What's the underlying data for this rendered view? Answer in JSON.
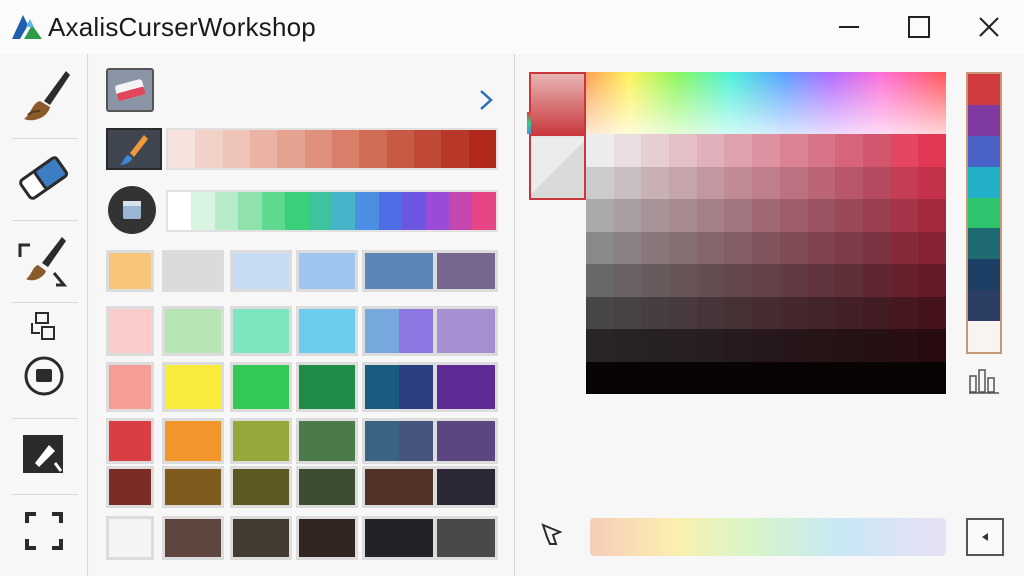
{
  "window": {
    "title": "AxalisCurserWorkshop",
    "controls": [
      "minimize",
      "maximize",
      "close"
    ]
  },
  "left_toolbar": {
    "tools": [
      "paintbrush-icon",
      "eraser-icon",
      "recolor-brush-icon",
      "replace-color-icon",
      "fill-mode-icon",
      "color-picker-icon",
      "selection-icon"
    ]
  },
  "palette": {
    "gradient_warm": [
      "#f6e3dd",
      "#f2d2c8",
      "#efc4b8",
      "#ebb3a5",
      "#e6a291",
      "#e0917d",
      "#d97f69",
      "#d06b55",
      "#c85a44",
      "#bf4836",
      "#b73828",
      "#b2291b"
    ],
    "gradient_spectrum": [
      "#ffffff",
      "#d9f5e1",
      "#b6ecc7",
      "#8fe2ab",
      "#5fd98e",
      "#39d07a",
      "#3dc49f",
      "#46b4c9",
      "#4b8fe3",
      "#4f6ee6",
      "#6a56e0",
      "#9a4cd8",
      "#c646b0",
      "#e64484"
    ],
    "top_row": [
      "#f8c67a",
      "#dadada",
      "#c6dcf2",
      "#9cc6ee",
      "#5b86b6",
      "#75678f"
    ],
    "rows": [
      [
        {
          "c": "#fbcaca"
        },
        {
          "c": "#b6e6b5"
        },
        {
          "c": "#7de6bf"
        },
        {
          "c": "#6dccec"
        },
        {
          "split": [
            "#76a8de",
            "#8e76e2"
          ]
        },
        {
          "c": "#a68fd0"
        }
      ],
      [
        {
          "c": "#f69d96"
        },
        {
          "c": "#f9eb3c"
        },
        {
          "c": "#34c956"
        },
        {
          "c": "#1f8c49"
        },
        {
          "split": [
            "#1a5b80",
            "#2b3f82"
          ]
        },
        {
          "c": "#5e2b95"
        }
      ],
      [
        {
          "c": "#d93e43"
        },
        {
          "c": "#f2962b"
        },
        {
          "c": "#97a739"
        },
        {
          "c": "#4a7b48"
        },
        {
          "split": [
            "#3b6383",
            "#465480"
          ]
        },
        {
          "c": "#5c4680"
        }
      ],
      [
        {
          "c": "#7b2c25"
        },
        {
          "c": "#7e5a1c"
        },
        {
          "c": "#5c5a22"
        },
        {
          "c": "#3d4d31"
        },
        {
          "c": "#533128"
        },
        {
          "c": "#2c2838"
        }
      ],
      [
        {
          "c": "#f4f4f4"
        },
        {
          "c": "#5e463f"
        },
        {
          "c": "#433c33"
        },
        {
          "c": "#332521"
        },
        {
          "c": "#232327"
        },
        {
          "c": "#494949"
        }
      ]
    ]
  },
  "picker": {
    "preview_current": "#c8373b",
    "preview_previous": "#e5e5e5",
    "grid_cols": 13,
    "grid_rows": 8,
    "vertical_strip": [
      "#d23b3e",
      "#7d3aa0",
      "#4a63c8",
      "#21b0c8",
      "#2ec46e",
      "#1e6b73",
      "#1c3f66",
      "#2a3d63",
      "#f8f4f2"
    ]
  }
}
